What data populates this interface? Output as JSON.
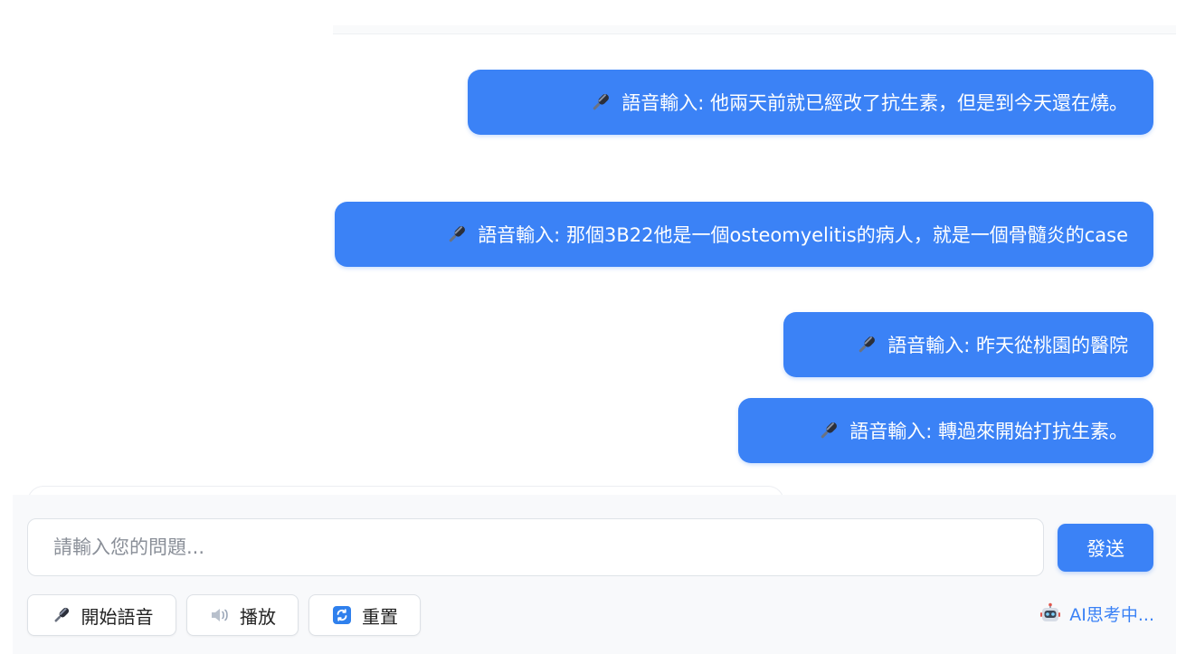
{
  "messages": [
    {
      "prefix": "語音輸入:",
      "text": "他兩天前就已經改了抗生素，但是到今天還在燒。",
      "icon": "microphone-icon"
    },
    {
      "prefix": "語音輸入:",
      "text": "那個3B22他是一個osteomyelitis的病人，就是一個骨髓炎的case",
      "icon": "microphone-icon"
    },
    {
      "prefix": "語音輸入:",
      "text": "昨天從桃園的醫院",
      "icon": "microphone-icon"
    },
    {
      "prefix": "語音輸入:",
      "text": "轉過來開始打抗生素。",
      "icon": "microphone-icon"
    }
  ],
  "input": {
    "placeholder": "請輸入您的問題...",
    "value": ""
  },
  "send_label": "發送",
  "toolbar": {
    "voice_label": "開始語音",
    "play_label": "播放",
    "reset_label": "重置"
  },
  "status": {
    "text": "AI思考中...",
    "icon": "robot-icon"
  },
  "colors": {
    "accent": "#3b82f6",
    "panel": "#f8f9fb"
  }
}
